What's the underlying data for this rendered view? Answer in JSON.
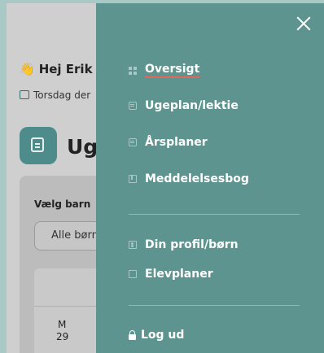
{
  "background": {
    "greeting": "Hej Erik",
    "wave_icon": "👋",
    "date": "Torsdag der",
    "page_title": "Uge",
    "child_label": "Vælg barn",
    "child_select_value": "Alle børn",
    "day_name": "M",
    "day_number": "29"
  },
  "drawer": {
    "close_icon": "close-icon",
    "items_main": [
      {
        "label": "Oversigt",
        "icon": "grid-icon",
        "active": true
      },
      {
        "label": "Ugeplan/lektie",
        "icon": "calendar-icon"
      },
      {
        "label": "Årsplaner",
        "icon": "calendar-icon"
      },
      {
        "label": "Meddelelsesbog",
        "icon": "book-icon"
      }
    ],
    "items_account": [
      {
        "label": "Din profil/børn",
        "icon": "profile-icon"
      },
      {
        "label": "Elevplaner",
        "icon": "folder-icon"
      }
    ],
    "logout": "Log ud"
  },
  "colors": {
    "drawer_bg": "#5e9490",
    "active_underline": "#e8655a",
    "accent": "#4e8c8c"
  }
}
